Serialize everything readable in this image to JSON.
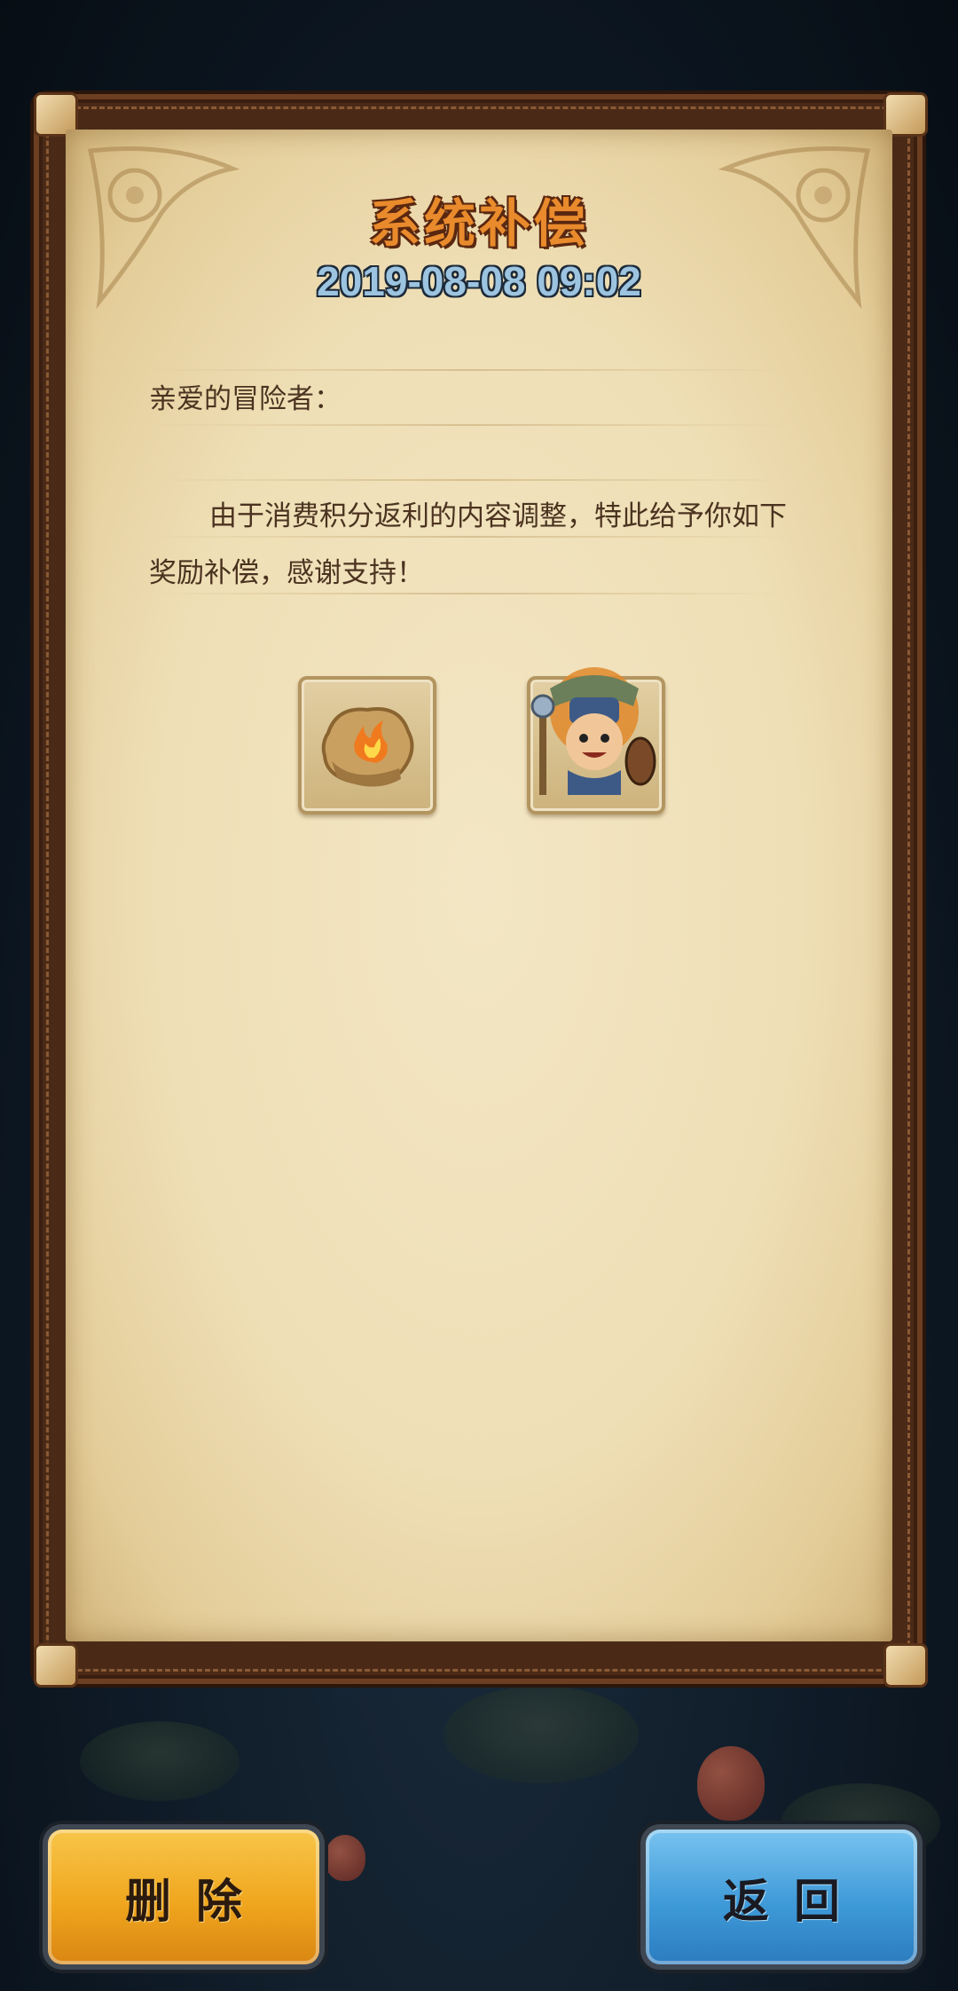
{
  "mail": {
    "title": "系统补偿",
    "date": "2019-08-08 09:02",
    "greeting": "亲爱的冒险者：",
    "body": "由于消费积分返利的内容调整，特此给予你如下奖励补偿，感谢支持！"
  },
  "rewards": [
    {
      "icon": "fire-stone-icon"
    },
    {
      "icon": "hero-avatar-icon"
    }
  ],
  "buttons": {
    "delete_label": "删除",
    "back_label": "返回"
  },
  "colors": {
    "title": "#e98a2c",
    "date": "#9cc4e0",
    "parchment": "#efdfb6",
    "delete_button": "#f0a61e",
    "back_button": "#3f9ad8"
  }
}
